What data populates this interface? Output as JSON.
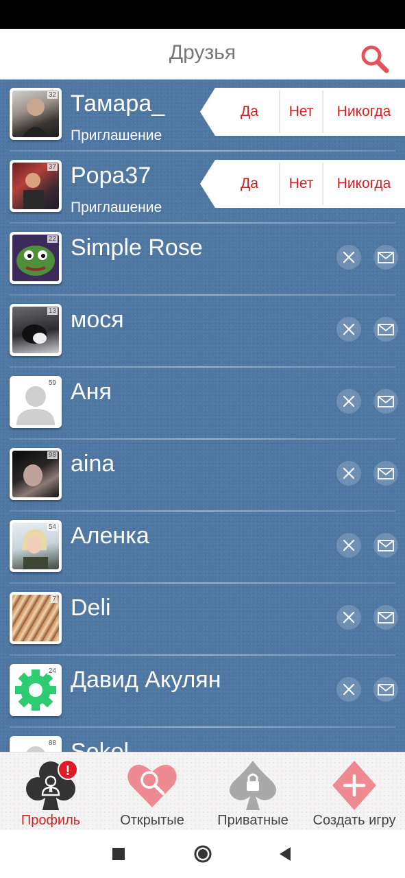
{
  "header": {
    "title": "Друзья"
  },
  "invite_actions": {
    "yes": "Да",
    "no": "Нет",
    "never": "Никогда"
  },
  "friends": [
    {
      "name": "Тамара_",
      "status": "Приглашение",
      "level": "32",
      "invite": true
    },
    {
      "name": "Popa37",
      "status": "Приглашение",
      "level": "37",
      "invite": true
    },
    {
      "name": "Simple Rose",
      "level": "22",
      "invite": false
    },
    {
      "name": "мося",
      "level": "13",
      "invite": false
    },
    {
      "name": "Аня",
      "level": "59",
      "invite": false
    },
    {
      "name": "aina",
      "level": "98",
      "invite": false
    },
    {
      "name": "Аленка",
      "level": "54",
      "invite": false
    },
    {
      "name": "Deli",
      "level": "7",
      "invite": false
    },
    {
      "name": "Давид Акулян",
      "level": "24",
      "invite": false
    },
    {
      "name": "Sokol",
      "level": "88",
      "invite": false
    }
  ],
  "tabs": [
    {
      "label": "Профиль",
      "active": true,
      "badge": "!",
      "icon": "club-profile-icon"
    },
    {
      "label": "Открытые",
      "active": false,
      "icon": "heart-search-icon"
    },
    {
      "label": "Приватные",
      "active": false,
      "icon": "spade-lock-icon"
    },
    {
      "label": "Создать игру",
      "active": false,
      "icon": "diamond-plus-icon"
    }
  ],
  "colors": {
    "accent": "#d81f1f",
    "list_background": "#4e77a3",
    "search_icon": "#e5505a"
  }
}
